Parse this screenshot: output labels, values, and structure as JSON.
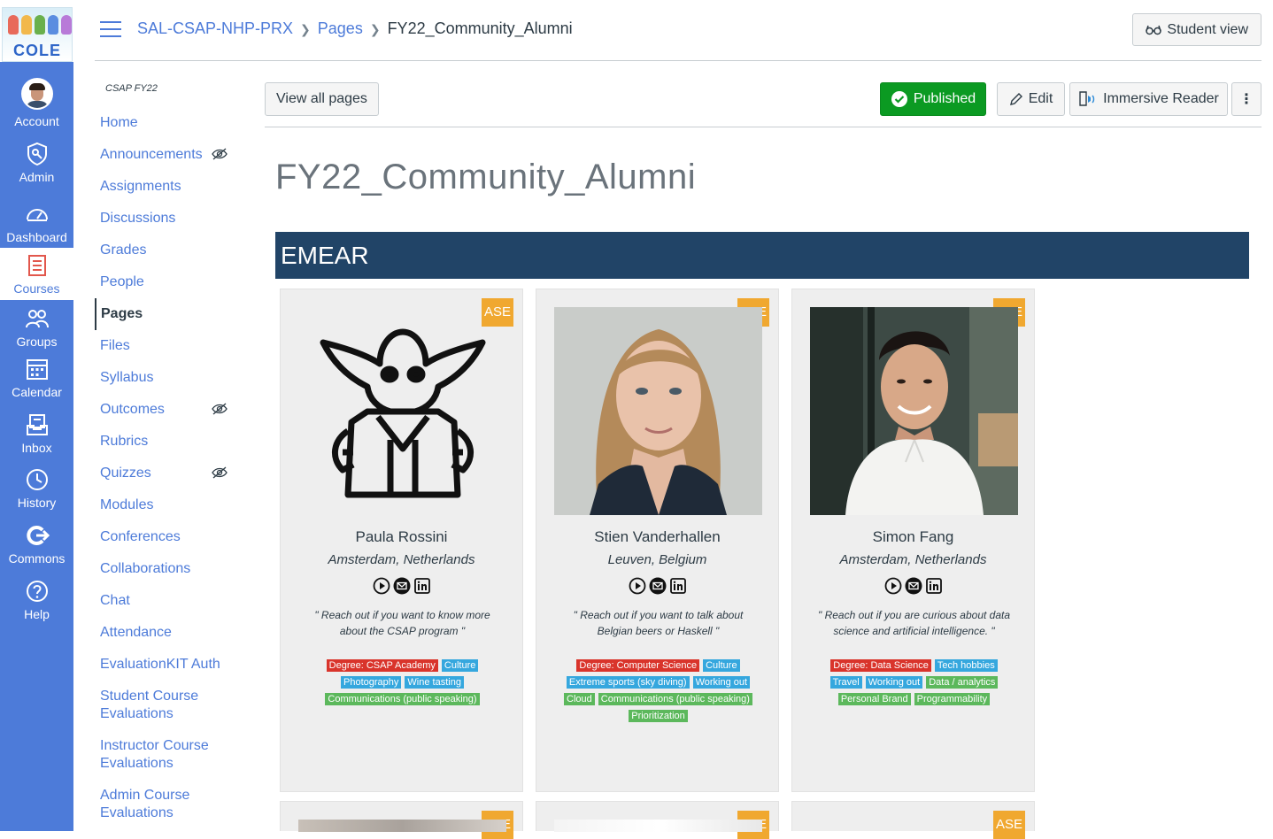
{
  "global_nav": {
    "items": [
      {
        "label": "Account"
      },
      {
        "label": "Admin"
      },
      {
        "label": "Dashboard"
      },
      {
        "label": "Courses"
      },
      {
        "label": "Groups"
      },
      {
        "label": "Calendar"
      },
      {
        "label": "Inbox"
      },
      {
        "label": "History"
      },
      {
        "label": "Commons"
      },
      {
        "label": "Help"
      }
    ],
    "logo_text": "COLE"
  },
  "breadcrumb": {
    "course": "SAL-CSAP-NHP-PRX",
    "section": "Pages",
    "current": "FY22_Community_Alumni"
  },
  "header": {
    "student_view_label": "Student view"
  },
  "course_nav": {
    "term": "CSAP FY22",
    "items": [
      {
        "label": "Home"
      },
      {
        "label": "Announcements",
        "hidden": true
      },
      {
        "label": "Assignments"
      },
      {
        "label": "Discussions"
      },
      {
        "label": "Grades"
      },
      {
        "label": "People"
      },
      {
        "label": "Pages",
        "active": true
      },
      {
        "label": "Files"
      },
      {
        "label": "Syllabus"
      },
      {
        "label": "Outcomes",
        "hidden": true
      },
      {
        "label": "Rubrics"
      },
      {
        "label": "Quizzes",
        "hidden": true
      },
      {
        "label": "Modules"
      },
      {
        "label": "Conferences"
      },
      {
        "label": "Collaborations"
      },
      {
        "label": "Chat"
      },
      {
        "label": "Attendance"
      },
      {
        "label": "EvaluationKIT Auth"
      },
      {
        "label": "Student Course Evaluations"
      },
      {
        "label": "Instructor Course Evaluations"
      },
      {
        "label": "Admin Course Evaluations"
      }
    ]
  },
  "toolbar": {
    "view_all_label": "View all pages",
    "published_label": "Published",
    "edit_label": "Edit",
    "immersive_label": "Immersive Reader",
    "more_label": "⋮"
  },
  "page": {
    "title": "FY22_Community_Alumni",
    "region": "EMEAR"
  },
  "colors": {
    "nav_blue": "#4d7bd9",
    "region_bar": "#214467",
    "badge": "#f0a830",
    "published": "#0b9a22",
    "tag_red": "#d9342b",
    "tag_blue": "#35a7de",
    "tag_green": "#5cb85c"
  },
  "alumni": [
    {
      "badge": "ASE",
      "name": "Paula Rossini",
      "location": "Amsterdam, Netherlands",
      "quote": "\" Reach out if you want to know more about the CSAP program \"",
      "tags": [
        {
          "text": "Degree: CSAP Academy",
          "color": "red"
        },
        {
          "text": "Culture",
          "color": "blue"
        },
        {
          "text": "Photography",
          "color": "blue"
        },
        {
          "text": "Wine tasting",
          "color": "blue"
        },
        {
          "text": "Communications (public speaking)",
          "color": "green"
        }
      ]
    },
    {
      "badge": "ASE",
      "name": "Stien Vanderhallen",
      "location": "Leuven, Belgium",
      "quote": "\" Reach out if you want to talk about Belgian beers or Haskell \"",
      "tags": [
        {
          "text": "Degree: Computer Science",
          "color": "red"
        },
        {
          "text": "Culture",
          "color": "blue"
        },
        {
          "text": "Extreme sports (sky diving)",
          "color": "blue"
        },
        {
          "text": "Working out",
          "color": "blue"
        },
        {
          "text": "Cloud",
          "color": "green"
        },
        {
          "text": "Communications (public speaking)",
          "color": "green"
        },
        {
          "text": "Prioritization",
          "color": "green"
        }
      ]
    },
    {
      "badge": "ASE",
      "name": "Simon Fang",
      "location": "Amsterdam, Netherlands",
      "quote": "\" Reach out if you are curious about data science and artificial intelligence. \"",
      "tags": [
        {
          "text": "Degree: Data Science",
          "color": "red"
        },
        {
          "text": "Tech hobbies",
          "color": "blue"
        },
        {
          "text": "Travel",
          "color": "blue"
        },
        {
          "text": "Working out",
          "color": "blue"
        },
        {
          "text": "Data / analytics",
          "color": "green"
        },
        {
          "text": "Personal Brand",
          "color": "green"
        },
        {
          "text": "Programmability",
          "color": "green"
        }
      ]
    }
  ],
  "second_row_badges": [
    "ASE",
    "ASE",
    "ASE"
  ]
}
